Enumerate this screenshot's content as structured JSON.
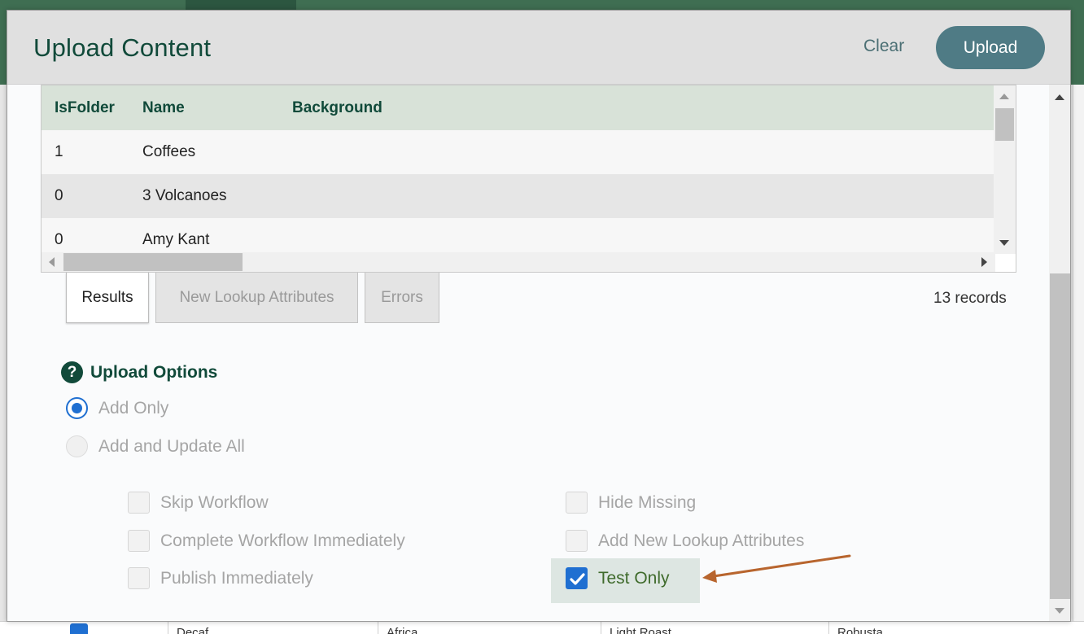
{
  "modal": {
    "title": "Upload Content",
    "clear_label": "Clear",
    "upload_label": "Upload"
  },
  "grid": {
    "columns": [
      "IsFolder",
      "Name",
      "Background"
    ],
    "rows": [
      {
        "isfolder": "1",
        "name": "Coffees",
        "background": ""
      },
      {
        "isfolder": "0",
        "name": "3 Volcanoes",
        "background": ""
      },
      {
        "isfolder": "0",
        "name": "Amy Kant",
        "background": ""
      }
    ]
  },
  "tabs": {
    "results": "Results",
    "new_lookup": "New Lookup Attributes",
    "errors": "Errors",
    "active": "Results"
  },
  "records_text": "13 records",
  "options": {
    "title": "Upload Options",
    "help_glyph": "?",
    "radios": [
      {
        "label": "Add Only",
        "checked": true
      },
      {
        "label": "Add and Update All",
        "checked": false
      }
    ],
    "checkboxes": {
      "skip_workflow": {
        "label": "Skip Workflow",
        "checked": false
      },
      "complete_workflow": {
        "label": "Complete Workflow Immediately",
        "checked": false
      },
      "publish_immediately": {
        "label": "Publish Immediately",
        "checked": false
      },
      "hide_missing": {
        "label": "Hide Missing",
        "checked": false
      },
      "add_new_lookup": {
        "label": "Add New Lookup Attributes",
        "checked": false
      },
      "test_only": {
        "label": "Test Only",
        "checked": true
      }
    }
  },
  "background_row": {
    "cells": [
      "Decaf",
      "Africa",
      "Light Roast",
      "Robusta"
    ]
  },
  "colors": {
    "brand": "#114a3a",
    "upload_button": "#4f7b85",
    "accent_blue": "#1f6fd1",
    "annotation_arrow": "#b8652e"
  }
}
